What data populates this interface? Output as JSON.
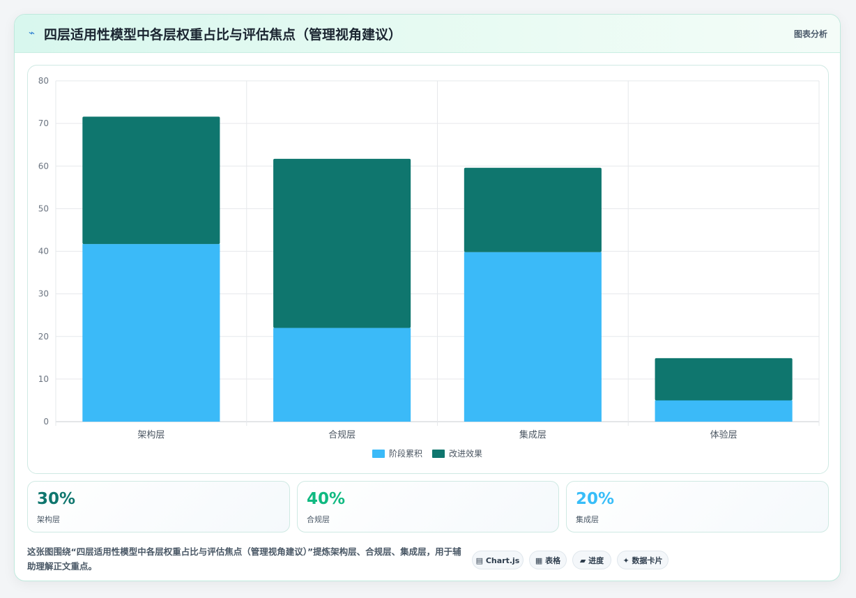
{
  "header": {
    "icon": "pulse-icon",
    "title": "四层适用性模型中各层权重占比与评估焦点（管理视角建议）",
    "action": "图表分析"
  },
  "chart_data": {
    "type": "bar",
    "stacked": true,
    "categories": [
      "架构层",
      "合规层",
      "集成层",
      "体验层"
    ],
    "series": [
      {
        "name": "阶段累积",
        "values": [
          41.7,
          22,
          39.8,
          5
        ],
        "color": "#3bbaf8"
      },
      {
        "name": "改进效果",
        "values": [
          29.9,
          39.7,
          19.8,
          9.9
        ],
        "color": "#0f766e"
      }
    ],
    "ylim": [
      0,
      80
    ],
    "yticks": [
      0,
      10,
      20,
      30,
      40,
      50,
      60,
      70,
      80
    ],
    "grid": true,
    "legend": "bottom-center"
  },
  "stats": [
    {
      "value": "30%",
      "label": "架构层",
      "color": "#0f766e"
    },
    {
      "value": "40%",
      "label": "合规层",
      "color": "#10b981"
    },
    {
      "value": "20%",
      "label": "集成层",
      "color": "#38bdf8"
    }
  ],
  "footer": {
    "text": "这张图围绕“四层适用性模型中各层权重占比与评估焦点（管理视角建议）”提炼架构层、合规层、集成层，用于辅助理解正文重点。",
    "tags": [
      "▤ Chart.js",
      "▦ 表格",
      "▰ 进度",
      "✦ 数据卡片"
    ]
  }
}
